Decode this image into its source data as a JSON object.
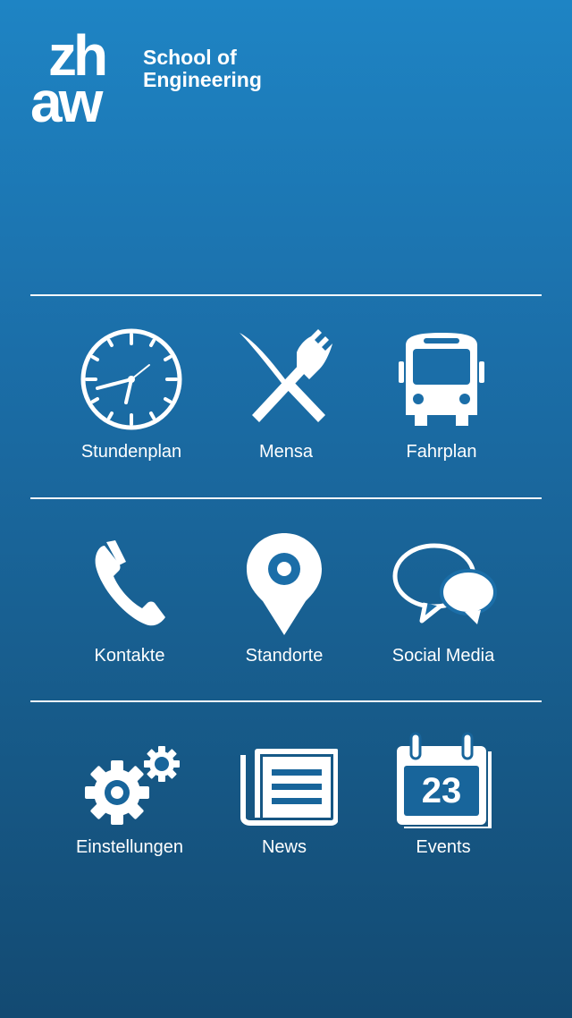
{
  "header": {
    "logo_top": "zh",
    "logo_bottom": "aw",
    "school_line1": "School of",
    "school_line2": "Engineering"
  },
  "menu": {
    "items": [
      {
        "label": "Stundenplan",
        "icon": "clock-icon"
      },
      {
        "label": "Mensa",
        "icon": "knife-fork-icon"
      },
      {
        "label": "Fahrplan",
        "icon": "bus-icon"
      },
      {
        "label": "Kontakte",
        "icon": "phone-icon"
      },
      {
        "label": "Standorte",
        "icon": "map-pin-icon"
      },
      {
        "label": "Social Media",
        "icon": "speech-bubbles-icon"
      },
      {
        "label": "Einstellungen",
        "icon": "gears-icon"
      },
      {
        "label": "News",
        "icon": "newspaper-icon"
      },
      {
        "label": "Events",
        "icon": "calendar-icon",
        "calendar_day": "23"
      }
    ]
  },
  "colors": {
    "background_top": "#1e84c4",
    "background_bottom": "#134a72",
    "foreground": "#ffffff"
  }
}
